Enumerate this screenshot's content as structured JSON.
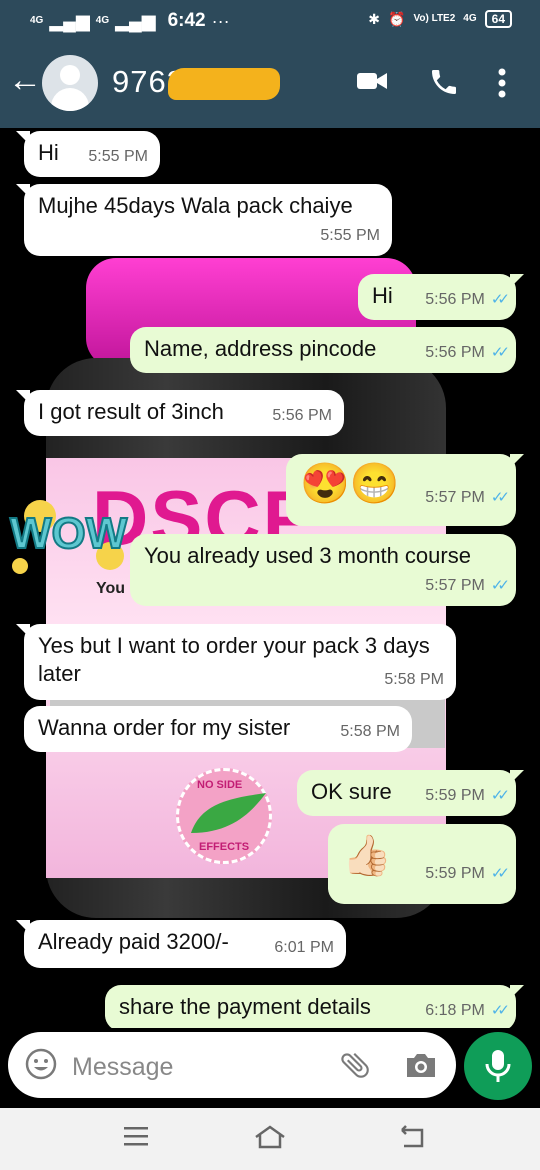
{
  "status": {
    "net1": "4G",
    "net2": "4G",
    "time": "6:42",
    "dots": "···",
    "volte": "Vo) LTE2",
    "net3": "4G",
    "battery": "64"
  },
  "header": {
    "contact": "9763",
    "contact_end": "3"
  },
  "background_text": {
    "you": "You",
    "letters": "DSCF"
  },
  "messages": [
    {
      "dir": "in",
      "text": "Hi",
      "time": "5:55 PM"
    },
    {
      "dir": "in",
      "text": "Mujhe 45days Wala pack chaiye",
      "time": "5:55 PM"
    },
    {
      "dir": "out",
      "text": "Hi",
      "time": "5:56 PM"
    },
    {
      "dir": "out",
      "text": "Name, address pincode",
      "time": "5:56 PM"
    },
    {
      "dir": "in",
      "text": "I got result of 3inch",
      "time": "5:56 PM"
    },
    {
      "dir": "out",
      "text": "😍😁",
      "time": "5:57 PM"
    },
    {
      "dir": "out",
      "text": "You already used 3 month course",
      "time": "5:57 PM"
    },
    {
      "dir": "in",
      "text": "Yes but I want to order your pack 3 days later",
      "time": "5:58 PM"
    },
    {
      "dir": "in",
      "text": "Wanna order for my sister",
      "time": "5:58 PM"
    },
    {
      "dir": "out",
      "text": "OK sure",
      "time": "5:59 PM"
    },
    {
      "dir": "out",
      "text": "👍🏻",
      "time": "5:59 PM"
    },
    {
      "dir": "in",
      "text": "Already paid 3200/-",
      "time": "6:01 PM"
    },
    {
      "dir": "out",
      "text": "share the payment details",
      "time": "6:18 PM"
    }
  ],
  "input": {
    "placeholder": "Message"
  },
  "seal": {
    "top": "NO SIDE",
    "bottom": "EFFECTS"
  },
  "colors": {
    "header": "#2d4a5b",
    "outgoing": "#e8fbd4",
    "incoming": "#ffffff",
    "mic": "#0f9d58",
    "ticks": "#4fb3e8"
  }
}
